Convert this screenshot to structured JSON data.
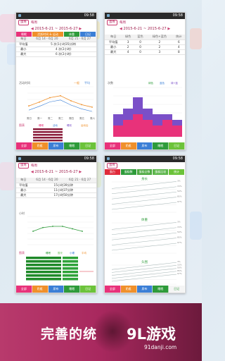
{
  "status_time": "09:58",
  "daterange": "2015-6-21 ~ 2015-6-27",
  "common": {
    "nav_back": "蛋疼",
    "nav_period": "每周"
  },
  "screen1": {
    "tabs": [
      "睡眠",
      "活跃时间 & 运动",
      "体重",
      "日记"
    ],
    "weeks": [
      "每日",
      "6月 14 - 6月 20",
      "6月 21 - 6月 27"
    ],
    "rows": [
      {
        "label": "平均值",
        "value": "5 次(1小时35分钟)"
      },
      {
        "label": "最小",
        "value": "4 次(2小时)"
      },
      {
        "label": "最大",
        "value": "6 次(2小时)"
      }
    ],
    "legend": [
      "一般",
      "平均"
    ],
    "ylabel": "活动时间",
    "xcats": [
      "周日",
      "周一",
      "周二",
      "周三",
      "周四",
      "周五",
      "周六"
    ],
    "line_values": [
      42,
      48,
      55,
      58,
      50,
      44,
      40
    ],
    "legend2": [
      "睡眠",
      "活动",
      "睡前",
      "运动后"
    ],
    "bars_title": "图表"
  },
  "screen2": {
    "headers": [
      "每日",
      "绿色",
      "蓝色",
      "绿色+蓝色",
      "统计"
    ],
    "rows": [
      {
        "label": "平均值",
        "v": [
          "3",
          "0",
          "2",
          "6"
        ]
      },
      {
        "label": "最小",
        "v": [
          "2",
          "0",
          "2",
          "4"
        ]
      },
      {
        "label": "最大",
        "v": [
          "4",
          "0",
          "3",
          "8"
        ]
      }
    ],
    "legend": [
      "绿色",
      "蓝色",
      "绿+蓝"
    ],
    "stack_pink": [
      2,
      3,
      4,
      3,
      2,
      3,
      2
    ],
    "stack_purple": [
      2,
      2,
      3,
      2,
      2,
      1,
      1
    ],
    "ylabel": "次数"
  },
  "screen3": {
    "weeks": [
      "每日",
      "6月 14 - 6月 20",
      "6月 21 - 6月 27"
    ],
    "rows": [
      {
        "label": "平均值",
        "value": "15小时39分钟"
      },
      {
        "label": "最小",
        "value": "11小时37分钟"
      },
      {
        "label": "最大",
        "value": "17小时50分钟"
      }
    ],
    "ylabel": "小时",
    "line_values": [
      14,
      15.5,
      16,
      16,
      15,
      14
    ],
    "legend": [
      "睡眠",
      "醒来",
      "小睡",
      "平均"
    ],
    "bars_title": "图表"
  },
  "screen4": {
    "tabs": [
      "蛋白",
      "蛋糕数",
      "蛋糕全数",
      "蛋糕比较",
      "统计"
    ],
    "section1": "身长",
    "section2": "体重",
    "section3": "头围",
    "percent_labels": [
      "97%",
      "85%",
      "50%",
      "15%",
      "3%"
    ]
  },
  "bottom_nav": [
    "全部",
    "奶瓶",
    "尿布",
    "睡眠",
    "日记"
  ],
  "banner": {
    "title": "完善的统",
    "logo": "9L游戏",
    "logo_sub": "91danji.com"
  },
  "colors": {
    "accent": "#c93a6f",
    "pink": "#e8327a",
    "purple": "#7a4fc8",
    "green": "#2e9b3a",
    "orange": "#f0902a"
  }
}
